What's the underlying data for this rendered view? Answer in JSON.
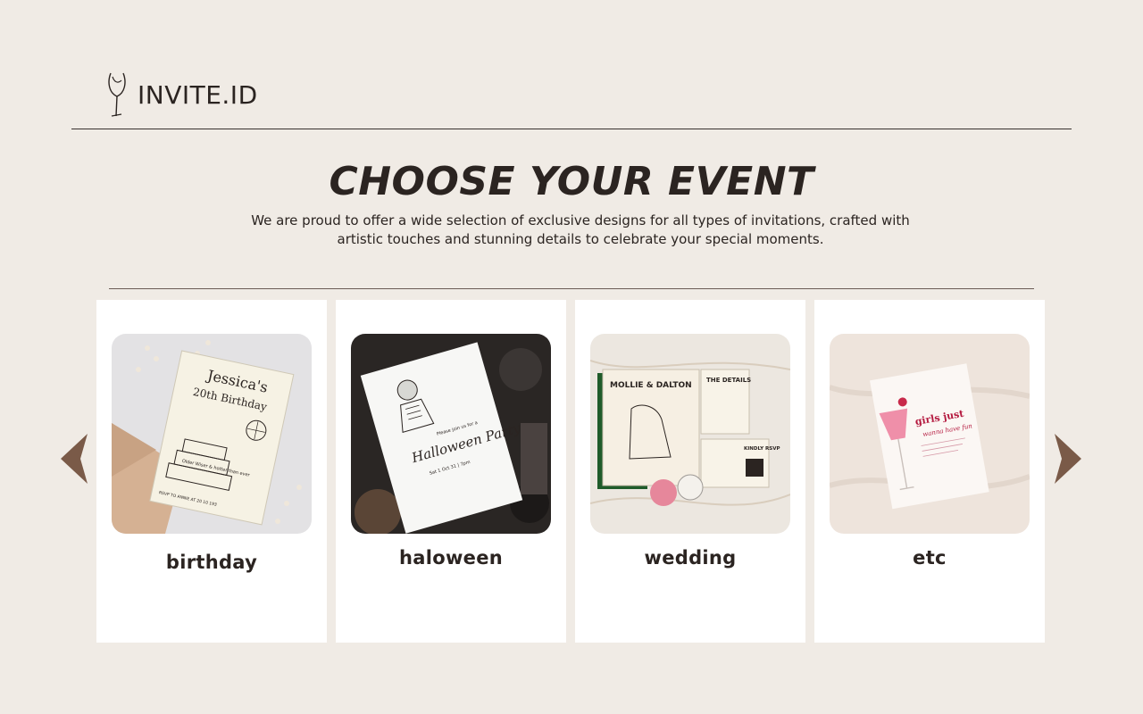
{
  "brand": {
    "name": "INVITE.ID",
    "logo_icon": "wine-glass-line-icon"
  },
  "hero": {
    "title": "CHOOSE YOUR EVENT",
    "subtitle": "We are proud to offer a wide selection of exclusive designs for all types of invitations, crafted with artistic touches and stunning details to celebrate your special moments."
  },
  "carousel": {
    "prev_icon": "chevron-left-icon",
    "next_icon": "chevron-right-icon",
    "arrow_color": "#7a5a48",
    "cards": [
      {
        "label": "birthday",
        "invite_text": {
          "line1": "Jessica's",
          "line2": "20th Birthday",
          "cake": "Older Wiser & hotter than ever",
          "rsvp": "RSVP TO ANNIE AT 20 10 193"
        }
      },
      {
        "label": "haloween",
        "invite_text": {
          "intro": "Please join us for a",
          "title": "Halloween Party",
          "date": "Sat 1 Oct 31 | 7pm"
        }
      },
      {
        "label": "wedding",
        "invite_text": {
          "names": "MOLLIE & DALTON",
          "details": "THE DETAILS",
          "rsvp": "KINDLY RSVP"
        }
      },
      {
        "label": "etc",
        "invite_text": {
          "title": "girls just",
          "script": "wanna have fun"
        }
      }
    ]
  }
}
